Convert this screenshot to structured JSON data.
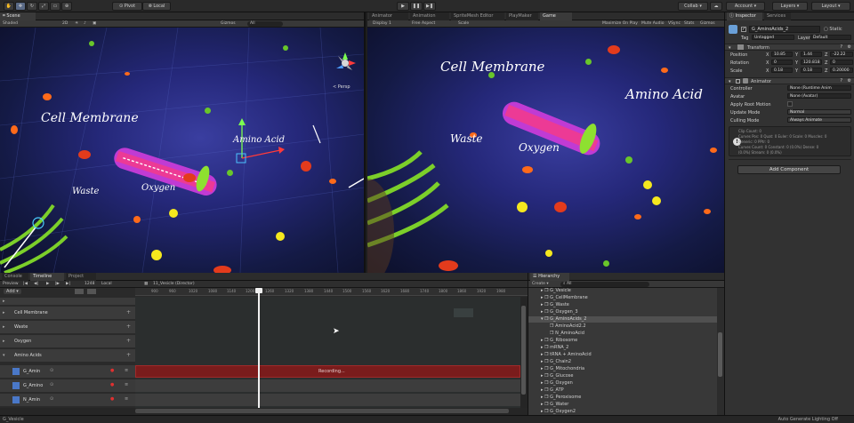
{
  "toolbar": {
    "pivot": "Pivot",
    "local": "Local",
    "collab": "Collab",
    "account": "Account",
    "layers": "Layers",
    "layout": "Layout",
    "tools": [
      "hand-tool",
      "move-tool",
      "rotate-tool",
      "scale-tool",
      "rect-tool",
      "transform-tool"
    ]
  },
  "scene": {
    "tab": "Scene",
    "shading": "Shaded",
    "mode_2d": "2D",
    "gizmos": "Gizmos",
    "search": "All",
    "persp": "< Persp",
    "labels": {
      "cell_membrane": "Cell Membrane",
      "amino_acid": "Amino Acid",
      "waste": "Waste",
      "oxygen": "Oxygen"
    }
  },
  "game": {
    "tabs": [
      "Animator",
      "Animation",
      "SpriteMesh Editor",
      "PlayMaker",
      "Game"
    ],
    "active_tab": "Game",
    "display": "Display 1",
    "aspect": "Free Aspect",
    "scale_label": "Scale",
    "options": [
      "Maximize On Play",
      "Mute Audio",
      "VSync",
      "Stats",
      "Gizmos"
    ],
    "labels": {
      "cell_membrane": "Cell Membrane",
      "amino_acid": "Amino Acid",
      "waste": "Waste",
      "oxygen": "Oxygen"
    }
  },
  "inspector": {
    "tabs": [
      "Inspector",
      "Services"
    ],
    "object_name": "G_AminoAcids_2",
    "static": "Static",
    "tag_label": "Tag",
    "tag_value": "Untagged",
    "layer_label": "Layer",
    "layer_value": "Default",
    "transform": {
      "title": "Transform",
      "position_label": "Position",
      "rotation_label": "Rotation",
      "scale_label": "Scale",
      "position": {
        "x": "10.85",
        "y": "1.44",
        "z": "-22.22"
      },
      "rotation": {
        "x": "0",
        "y": "120.818",
        "z": "0"
      },
      "scale": {
        "x": "0.18",
        "y": "0.18",
        "z": "0.20000"
      }
    },
    "animator": {
      "title": "Animator",
      "controller_label": "Controller",
      "controller_value": "None (Runtime Anim",
      "avatar_label": "Avatar",
      "avatar_value": "None (Avatar)",
      "root_motion_label": "Apply Root Motion",
      "update_label": "Update Mode",
      "update_value": "Normal",
      "culling_label": "Culling Mode",
      "culling_value": "Always Animate",
      "info": [
        "Clip Count: 0",
        "Curves Pos: 0 Quat: 0 Euler: 0 Scale: 0 Muscles: 0",
        "Generic: 0 PPtr: 0",
        "Curves Count: 0 Constant: 0 (0.0%) Dense: 0",
        "(0.0%) Stream: 0 (0.0%)"
      ]
    },
    "add_component": "Add Component"
  },
  "bottom_tabs": [
    "Console",
    "Timeline",
    "Project"
  ],
  "timeline": {
    "preview": "Preview",
    "frame": "1248",
    "local": "Local",
    "add": "Add",
    "director": "11_Vesicle (Director)",
    "ruler": [
      "900",
      "960",
      "1020",
      "1080",
      "1140",
      "1200",
      "1260",
      "1320",
      "1380",
      "1440",
      "1500",
      "1560",
      "1620",
      "1680",
      "1740",
      "1800",
      "1860",
      "1920",
      "1980"
    ],
    "tracks": [
      "Cell Membrane",
      "Waste",
      "Oxygen",
      "Amino Acids"
    ],
    "anim_tracks": [
      "G_Amin",
      "G_Amino",
      "N_Amin"
    ],
    "recording": "Recording..."
  },
  "hierarchy": {
    "tab": "Hierarchy",
    "create": "Create",
    "search": "All",
    "items": [
      "G_Vesicle",
      "G_CellMembrane",
      "G_Waste",
      "G_Oxygen_3",
      "G_AminoAcids_2",
      "AminoAcid2.2",
      "N_AminoAcid",
      "G_Ribosome",
      "mRNA_2",
      "tRNA + AminoAcid",
      "G_Chain2",
      "G_Mitochondria",
      "G_Glucose",
      "G_Oxygen",
      "G_ATP",
      "G_Peroxisome",
      "G_Water",
      "G_Oxygen2"
    ],
    "selected": "G_AminoAcids_2"
  },
  "status": {
    "left": "G_Vesicle",
    "right": "Auto Generate Lighting Off"
  }
}
